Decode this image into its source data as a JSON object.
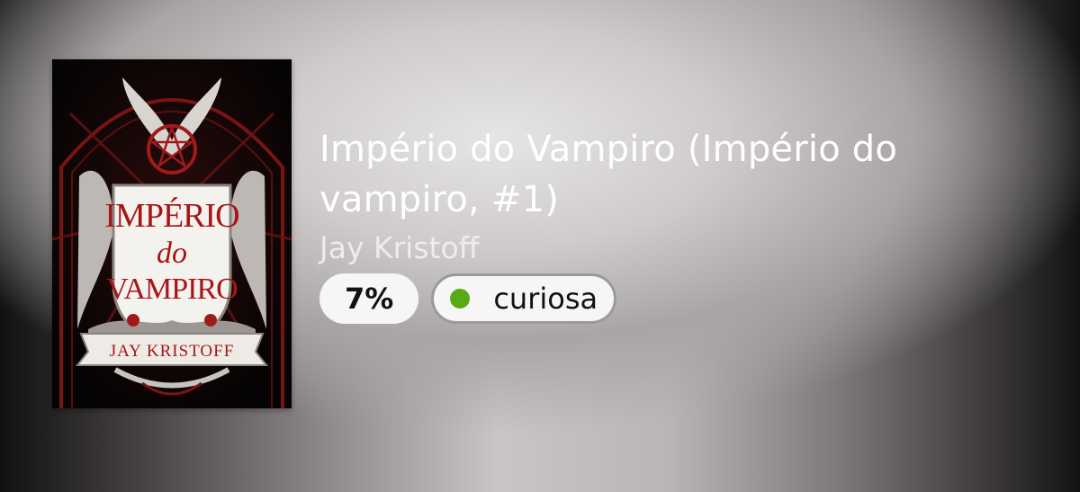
{
  "book": {
    "title": "Império do Vampiro (Império do vampiro, #1)",
    "author": "Jay Kristoff",
    "progress": {
      "value_percent": 7,
      "label": "7%"
    },
    "status": {
      "label": "curiosa",
      "dot_color": "#5aaa16"
    },
    "cover": {
      "title_line1": "IMPÉRIO",
      "title_line2": "do",
      "title_line3": "VAMPIRO",
      "author": "JAY KRISTOFF"
    }
  }
}
